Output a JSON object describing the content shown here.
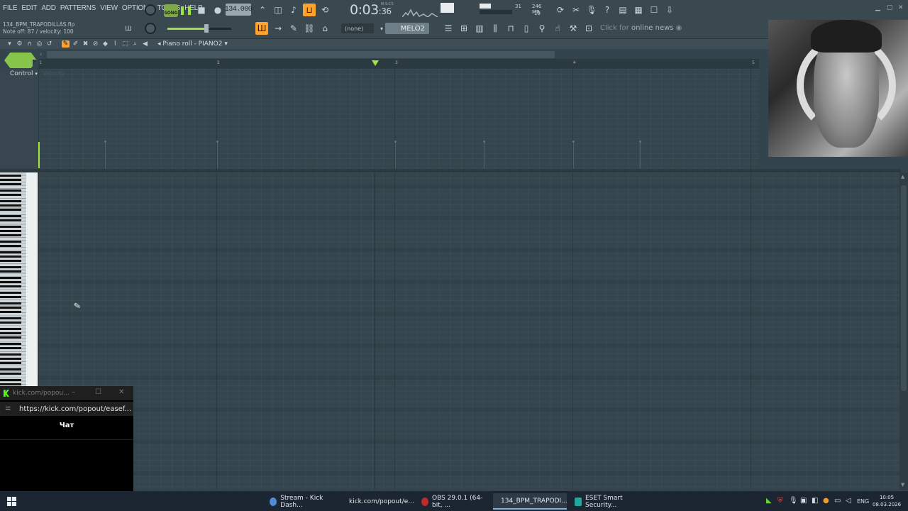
{
  "menu": [
    "FILE",
    "EDIT",
    "ADD",
    "PATTERNS",
    "VIEW",
    "OPTIONS",
    "TOOLS",
    "HELP"
  ],
  "project_file": "134_BPM_TRAPODILLAS.flp",
  "hint_line": "Note off: 87 / velocity: 100",
  "transport": {
    "song_label": "SONG",
    "tempo": "134.000",
    "time_main": "0:03",
    "time_sub": ":36",
    "time_unit": "M:S:CS"
  },
  "cpu": {
    "voices": "31",
    "memory": "246 MB",
    "polyphony": "19"
  },
  "snap": "(none)",
  "pattern_name": "MELO2",
  "news": {
    "prefix": "Click for",
    "highlight": "online news"
  },
  "piano_roll": {
    "title": "Piano roll - PIANO2"
  },
  "timeline": {
    "bars": [
      "1",
      "2",
      "3",
      "4",
      "5"
    ]
  },
  "control_lane": {
    "label": "Control",
    "sub": "Velocity"
  },
  "popup": {
    "title": "kick.com/popou...",
    "url": "https://kick.com/popout/easef...",
    "chat": "Чат"
  },
  "taskbar": {
    "items": [
      {
        "label": "Stream - Kick Dash...",
        "color": "#4f8bd6"
      },
      {
        "label": "kick.com/popout/e...",
        "color": "#53fc18"
      },
      {
        "label": "OBS 29.0.1 (64-bit, ...",
        "color": "#bf2a2a"
      },
      {
        "label": "134_BPM_TRAPODI...",
        "color": "#f29a2e"
      },
      {
        "label": "ESET Smart Security...",
        "color": "#1fa7a0"
      }
    ],
    "lang": "ENG",
    "time": "10:05",
    "date": "08.03.2026"
  },
  "colors": {
    "accent_green": "#9fe53a",
    "accent_orange": "#ffa22f",
    "grid_bg": "#34454d"
  }
}
